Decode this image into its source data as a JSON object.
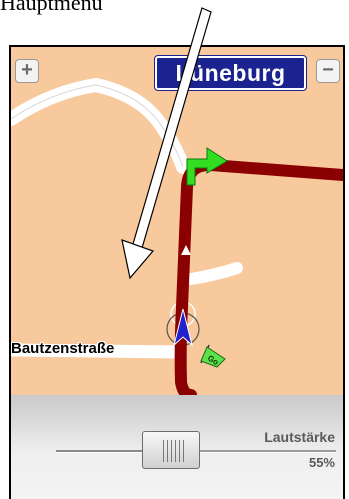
{
  "annotation": {
    "label": "Hauptmenu"
  },
  "map": {
    "city_name": "Lüneburg",
    "street_name": "Bautzenstraße",
    "zoom_in_symbol": "+",
    "zoom_out_symbol": "−",
    "go_flag_text": "Go",
    "colors": {
      "land": "#f7c99c",
      "road": "#ffffff",
      "route": "#8b0000",
      "turn_arrow": "#33dd22",
      "position_marker": "#2222cc",
      "city_badge": "#1a238f"
    },
    "icons": [
      "zoom-in-icon",
      "zoom-out-icon",
      "turn-arrow-icon",
      "position-arrow-icon",
      "go-flag-icon",
      "route-direction-icon"
    ]
  },
  "volume": {
    "label": "Lautstärke",
    "value_text": "55%",
    "level": 0.55
  }
}
